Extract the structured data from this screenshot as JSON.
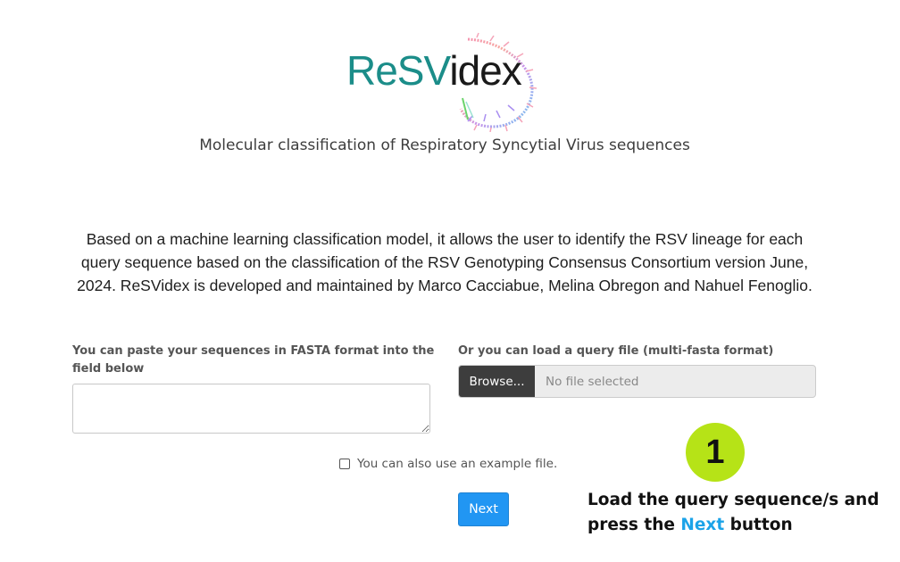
{
  "logo": {
    "part1": "ReSV",
    "part2": "idex",
    "teal_color": "#1b8d89"
  },
  "tagline": "Molecular classification of Respiratory Syncytial Virus sequences",
  "description": "Based on a machine learning classification model, it allows the user to identify the RSV lineage for each query sequence based on the classification of the RSV Genotyping Consensus Consortium version June, 2024. ReSVidex is developed and maintained by Marco Cacciabue, Melina Obregon and Nahuel Fenoglio.",
  "paste_section": {
    "label": "You can paste your sequences in FASTA format into the field below",
    "value": ""
  },
  "file_section": {
    "label": "Or you can load a query file (multi-fasta format)",
    "browse_label": "Browse...",
    "file_placeholder": "No file selected"
  },
  "example": {
    "label": "You can also use an example file.",
    "checked": false
  },
  "next_button": {
    "label": "Next",
    "color": "#2196f3"
  },
  "annotation": {
    "step_number": "1",
    "badge_color": "#b6e317",
    "text_before": "Load the query sequence/s and press the ",
    "highlight": "Next",
    "text_after": " button",
    "highlight_color": "#1ba3e8"
  }
}
